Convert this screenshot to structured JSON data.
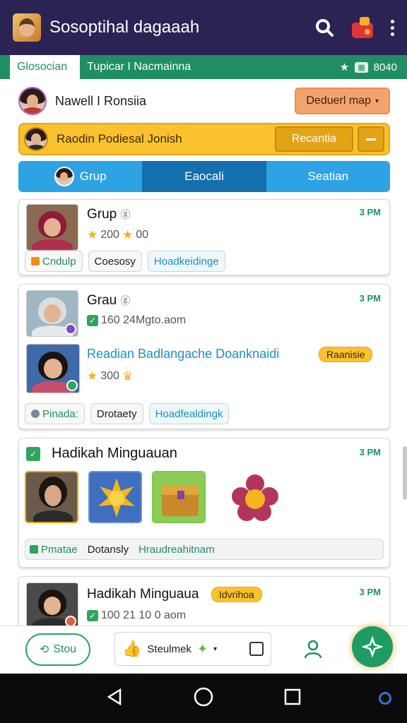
{
  "header": {
    "app_title": "Sosoptihal dagaaah",
    "icons": [
      "app-logo",
      "search-icon",
      "gift-icon",
      "more-icon"
    ]
  },
  "tabs": {
    "active": "Glosocian",
    "second": "Tupicar I Nacmainna",
    "counter": "8040"
  },
  "profile": {
    "name": "Nawell I Ronsiia",
    "action_label": "Deduerl map"
  },
  "promo": {
    "title": "Raodin Podiesal Jonish",
    "action_label": "Recantia"
  },
  "segments": [
    "Grup",
    "Eaocali",
    "Seatian"
  ],
  "cards": [
    {
      "title": "Grup",
      "time": "3 PM",
      "stat": "200",
      "stat_extra": "00",
      "chips": [
        "Cndulp",
        "Coesosy",
        "Hoadkeidinge"
      ]
    },
    {
      "title": "Grau",
      "time": "3 PM",
      "stat": "160 24Mgto.aom",
      "sub_title": "Readian Badlangache Doanknaidi",
      "sub_badge": "Raanisie",
      "sub_stat": "300",
      "chips": [
        "Pinada:",
        "Drotaety",
        "Hoadfealdingk"
      ]
    },
    {
      "title": "Hadikah Minguauan",
      "time": "3 PM",
      "chips": [
        "Pmatae",
        "Dotansly",
        "Hraudreahitnam"
      ]
    },
    {
      "title": "Hadikah Minguaua",
      "badge": "Idvrihoa",
      "time": "3 PM",
      "stat": "100 21 10 0 aom"
    }
  ],
  "bottom_nav": {
    "left_label": "Stou",
    "mid_label": "Steulmek"
  },
  "colors": {
    "topbar": "#2c2355",
    "green": "#1f8f63",
    "amber": "#f9c22e",
    "blue": "#2ea3e3"
  }
}
